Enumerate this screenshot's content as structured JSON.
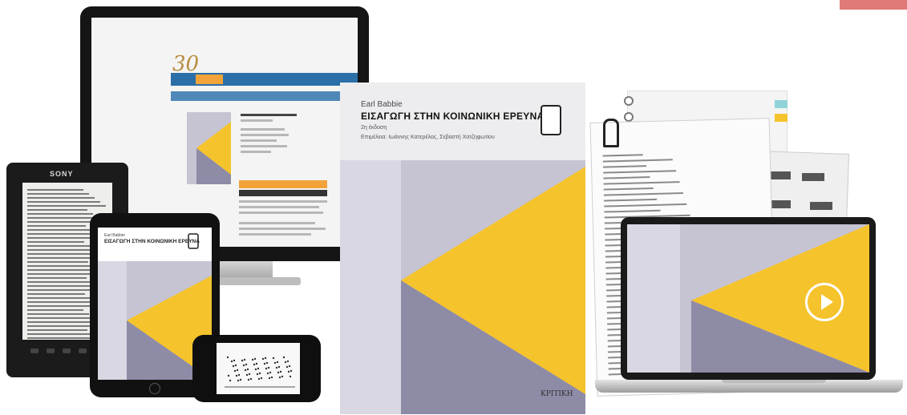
{
  "colors": {
    "yellow": "#f5c32c",
    "lavender": "#c6c4d3",
    "slate": "#8e8ba7",
    "site_blue": "#2a6fa8",
    "site_orange": "#f2a33a",
    "corner_accent": "#e07a78"
  },
  "ereader": {
    "brand": "SONY"
  },
  "site": {
    "logo_number": "30"
  },
  "book": {
    "author": "Earl Babbie",
    "title": "ΕΙΣΑΓΩΓΗ ΣΤΗΝ ΚΟΙΝΩΝΙΚΗ ΕΡΕΥΝΑ",
    "edition": "2η έκδοση",
    "editors": "Επιμέλεια: Ιωάννης Κατερέλος, Σεβαστή Χατζηφωτίου",
    "badge_icon": "tablet-icon",
    "publisher": "ΚΡΙΤΙΚΗ"
  },
  "tablet": {
    "author": "Earl Babbie",
    "title": "ΕΙΣΑΓΩΓΗ ΣΤΗΝ ΚΟΙΝΩΝΙΚΗ ΕΡΕΥΝΑ"
  },
  "laptop": {
    "play_icon": "play-icon"
  }
}
